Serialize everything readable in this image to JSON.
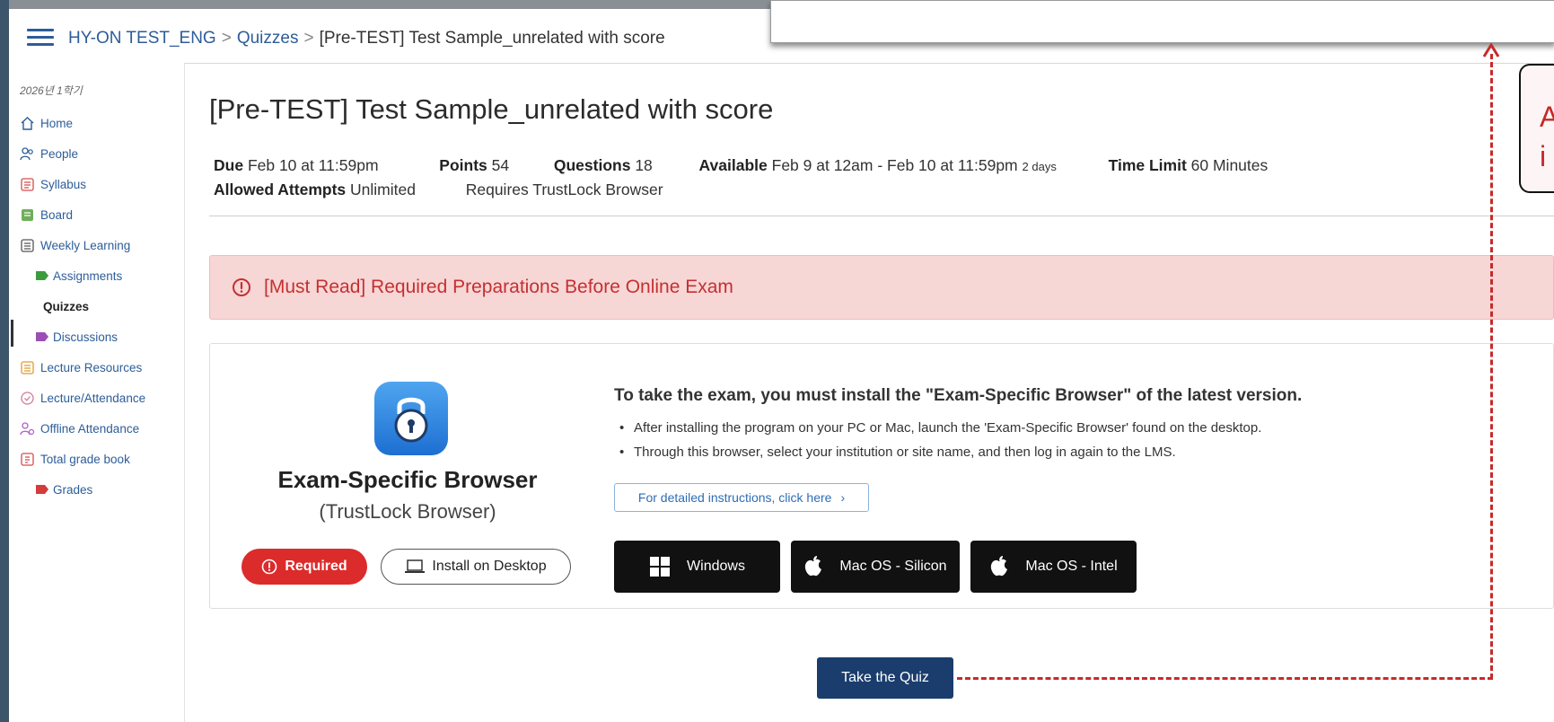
{
  "breadcrumb": {
    "course": "HY-ON TEST_ENG",
    "section": "Quizzes",
    "current": "[Pre-TEST] Test Sample_unrelated with score",
    "separator": ">"
  },
  "sidebar": {
    "term": "2026년 1학기",
    "items": [
      {
        "label": "Home",
        "icon": "home-icon"
      },
      {
        "label": "People",
        "icon": "people-icon"
      },
      {
        "label": "Syllabus",
        "icon": "syllabus-icon"
      },
      {
        "label": "Board",
        "icon": "board-icon"
      },
      {
        "label": "Weekly Learning",
        "icon": "weekly-learning-icon"
      },
      {
        "label": "Assignments",
        "icon": "tag-icon"
      },
      {
        "label": "Quizzes",
        "icon": ""
      },
      {
        "label": "Discussions",
        "icon": "tag-icon"
      },
      {
        "label": "Lecture Resources",
        "icon": "resources-icon"
      },
      {
        "label": "Lecture/Attendance",
        "icon": "check-circle-icon"
      },
      {
        "label": "Offline Attendance",
        "icon": "attendance-icon"
      },
      {
        "label": "Total grade book",
        "icon": "gradebook-icon"
      },
      {
        "label": "Grades",
        "icon": "tag-icon"
      }
    ],
    "active": "Quizzes"
  },
  "quiz": {
    "title": "[Pre-TEST] Test Sample_unrelated with score",
    "due_label": "Due",
    "due_value": "Feb 10 at 11:59pm",
    "points_label": "Points",
    "points_value": "54",
    "questions_label": "Questions",
    "questions_value": "18",
    "available_label": "Available",
    "available_value": "Feb 9 at 12am - Feb 10 at 11:59pm",
    "available_duration": "2 days",
    "time_limit_label": "Time Limit",
    "time_limit_value": "60 Minutes",
    "attempts_label": "Allowed Attempts",
    "attempts_value": "Unlimited",
    "requires_text": "Requires TrustLock Browser"
  },
  "alert": {
    "text": "[Must Read] Required Preparations Before Online Exam",
    "color": "#c53030",
    "background": "#f7d6d6"
  },
  "browser_card": {
    "app_name": "Exam-Specific Browser",
    "app_sub": "(TrustLock Browser)",
    "required_label": "Required",
    "install_label": "Install on Desktop",
    "info_title": "To take the exam, you must install the \"Exam-Specific Browser\" of the latest version.",
    "bullets": [
      "After installing the program on your PC or Mac, launch the 'Exam-Specific Browser' found on the desktop.",
      "Through this browser, select your institution or site name, and then log in again to the LMS."
    ],
    "details_link": "For detailed instructions, click here",
    "downloads": [
      {
        "label": "Windows",
        "icon": "windows-icon"
      },
      {
        "label": "Mac OS - Silicon",
        "icon": "apple-icon"
      },
      {
        "label": "Mac OS - Intel",
        "icon": "apple-icon"
      }
    ]
  },
  "take_quiz_label": "Take the Quiz",
  "annotation": {
    "callout_text": "A\ni",
    "color": "#c72a2a"
  },
  "colors": {
    "link": "#2d5d99",
    "primary_button": "#1a3d6d",
    "required_red": "#dc2b2b"
  }
}
